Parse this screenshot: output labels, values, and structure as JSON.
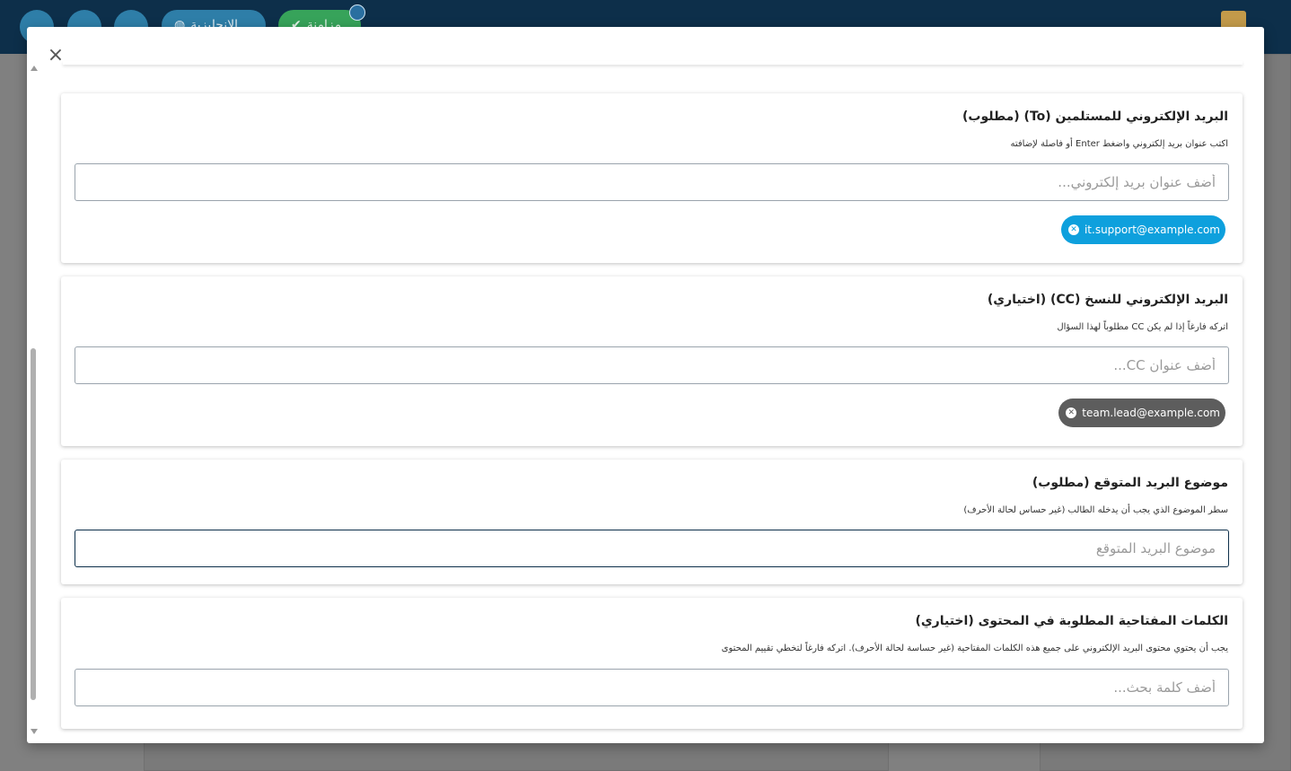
{
  "background": {
    "lang_button": "الإنجليزية",
    "sync_button": "مزامنة"
  },
  "modal": {
    "close_symbol": "×",
    "cards": [
      {
        "title": "البريد الإلكتروني للمستلمين (To) (مطلوب)",
        "hint": "اكتب عنوان بريد إلكتروني واضغط Enter أو فاصلة لإضافته",
        "placeholder": "أضف عنوان بريد إلكتروني...",
        "chip": "it.support@example.com"
      },
      {
        "title": "البريد الإلكتروني للنسخ (CC) (اختياري)",
        "hint": "اتركه فارغاً إذا لم يكن CC مطلوباً لهذا السؤال",
        "placeholder": "أضف عنوان CC...",
        "chip": "team.lead@example.com"
      },
      {
        "title": "موضوع البريد المتوقع (مطلوب)",
        "hint": "سطر الموضوع الذي يجب أن يدخله الطالب (غير حساس لحالة الأحرف)",
        "placeholder": "موضوع البريد المتوقع"
      },
      {
        "title": "الكلمات المفتاحية المطلوبة في المحتوى (اختياري)",
        "hint": "يجب أن يحتوي محتوى البريد الإلكتروني على جميع هذه الكلمات المفتاحية (غير حساسة لحالة الأحرف). اتركه فارغاً لتخطي تقييم المحتوى",
        "placeholder": "أضف كلمة بحث..."
      }
    ]
  },
  "colors": {
    "primary_navy": "#0d2f4a",
    "chip_blue": "#0ea0dd",
    "chip_grey": "#5d5d5d"
  }
}
